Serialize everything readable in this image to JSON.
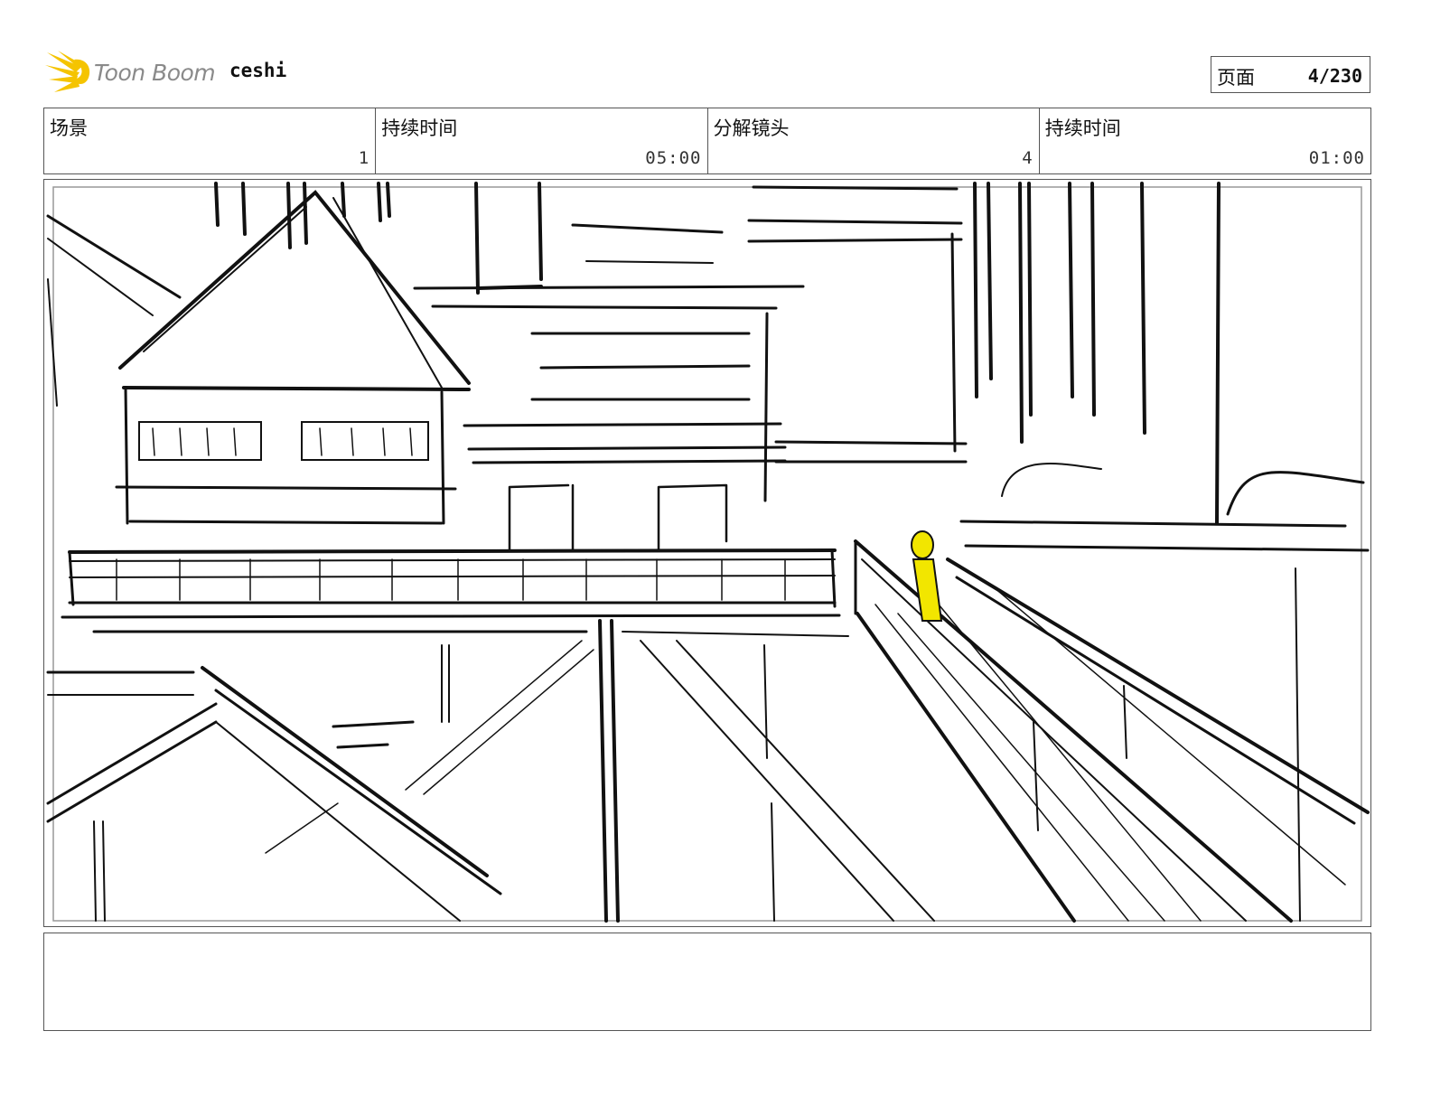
{
  "header": {
    "logo_text": "Toon Boom",
    "project_name": "ceshi",
    "page": {
      "label": "页面",
      "value": "4/230"
    }
  },
  "info": {
    "scene": {
      "label": "场景",
      "value": "1"
    },
    "scene_duration": {
      "label": "持续时间",
      "value": "05:00"
    },
    "panel": {
      "label": "分解镜头",
      "value": "4"
    },
    "panel_duration": {
      "label": "持续时间",
      "value": "01:00"
    }
  },
  "caption": {
    "text": ""
  },
  "colors": {
    "logo_accent": "#f5c400",
    "character_highlight": "#f2e600"
  },
  "icons": {
    "logo": "toon-boom-sunburst-icon"
  }
}
